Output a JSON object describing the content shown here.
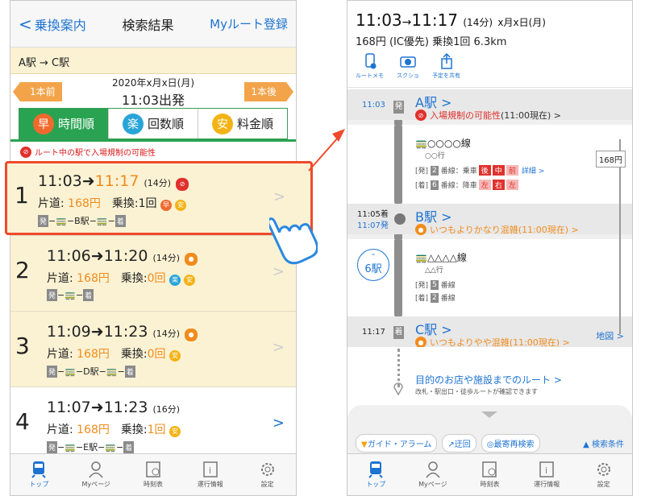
{
  "left": {
    "nav": {
      "back": "乗換案内",
      "title": "検索結果",
      "myroute": "Myルート登録"
    },
    "route": "A駅 → C駅",
    "prev": "1本前",
    "next": "1本後",
    "date": "2020年x月x日(月)",
    "depart": "11:03出発",
    "tabs": [
      {
        "icon": "早",
        "label": "時間順",
        "color": "#f06a2e"
      },
      {
        "icon": "楽",
        "label": "回数順",
        "color": "#28a4d8"
      },
      {
        "icon": "安",
        "label": "料金順",
        "color": "#f3b315"
      }
    ],
    "warning": "ルート中の駅で入場規制の可能性",
    "routes": [
      {
        "num": "1",
        "dep": "11:03",
        "arr": "11:17",
        "dur": "(14分)",
        "fare_label": "片道:",
        "fare": "168円",
        "transfer_label": "乗換:",
        "transfer": "1回",
        "via": "B駅"
      },
      {
        "num": "2",
        "dep": "11:06",
        "arr": "11:20",
        "dur": "(14分)",
        "fare_label": "片道:",
        "fare": "168円",
        "transfer_label": "乗換:",
        "transfer": "0回",
        "via": ""
      },
      {
        "num": "3",
        "dep": "11:09",
        "arr": "11:23",
        "dur": "(14分)",
        "fare_label": "片道:",
        "fare": "168円",
        "transfer_label": "乗換:",
        "transfer": "0回",
        "via": "D駅"
      },
      {
        "num": "4",
        "dep": "11:07",
        "arr": "11:23",
        "dur": "(16分)",
        "fare_label": "片道:",
        "fare": "168円",
        "transfer_label": "乗換:",
        "transfer": "1回",
        "via": "E駅"
      }
    ],
    "tabbar": [
      "トップ",
      "Myページ",
      "時刻表",
      "運行情報",
      "設定"
    ]
  },
  "right": {
    "dep": "11:03",
    "arrow": "→",
    "arr": "11:17",
    "dur": "(14分)",
    "date": "x月x日(月)",
    "summary": "168円 (IC優先) 乗換1回 6.3km",
    "tools": [
      "ルートメモ",
      "スクショ",
      "予定を共有"
    ],
    "a": {
      "time": "11:03",
      "name": "A駅 >",
      "warn": "入場規制の可能性",
      "warn_time": "(11:00現在) >",
      "tag": "発"
    },
    "line1": {
      "name": "○○○○線",
      "dest": "○○行",
      "plat1": "[発]",
      "plat1n": "2",
      "plat1t": "番線：乗車",
      "plat2": "[着]",
      "plat2n": "6",
      "plat2t": "番線：降車",
      "b1": "後",
      "b2": "中",
      "b3": "前",
      "b4": "左",
      "b5": "右",
      "b6": "左",
      "detail": "詳細 >"
    },
    "b": {
      "arr": "11:05着",
      "dep": "11:07発",
      "name": "B駅 >",
      "warn": "いつもよりかなり混雑",
      "warn_time": "(11:00現在) >"
    },
    "walk": "6駅",
    "line2": {
      "name": "△△△△線",
      "dest": "△△行",
      "plat1": "[発]",
      "plat1n": "5",
      "plat1t": "番線",
      "plat2": "[着]",
      "plat2n": "2",
      "plat2t": "番線"
    },
    "c": {
      "time": "11:17",
      "name": "C駅 >",
      "warn": "いつもよりやや混雑",
      "warn_time": "(11:00現在) >",
      "map": "地図 >",
      "tag": "着"
    },
    "fare": "168円",
    "dest_link": "目的のお店や施設までのルート >",
    "dest_sub": "改札・駅出口・徒歩ルートが確認できます",
    "bottom": [
      "ガイド・アラーム",
      "迂回",
      "最寄再検索"
    ],
    "cond": "▲ 検索条件",
    "tabbar": [
      "トップ",
      "Myページ",
      "時刻表",
      "運行情報",
      "設定"
    ]
  }
}
